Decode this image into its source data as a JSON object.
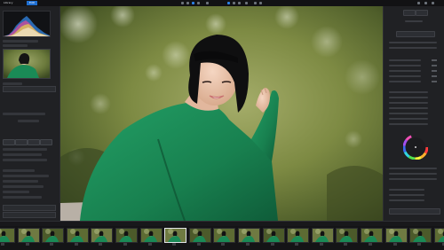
{
  "app": {
    "tabs": [
      "Library",
      "Edit"
    ],
    "active_tab": "Edit"
  },
  "colors": {
    "accent": "#1f6fd1",
    "panel": "#202124",
    "jacket": "#1a8a56"
  },
  "icons": [
    "histogram-icon",
    "color-wheel-icon",
    "image-icon"
  ],
  "left_panel": {
    "section_label": "",
    "field_label": ""
  },
  "right_panel": {
    "heading": ""
  },
  "filmstrip": {
    "label": "",
    "count": 20,
    "selected_index": 7
  }
}
